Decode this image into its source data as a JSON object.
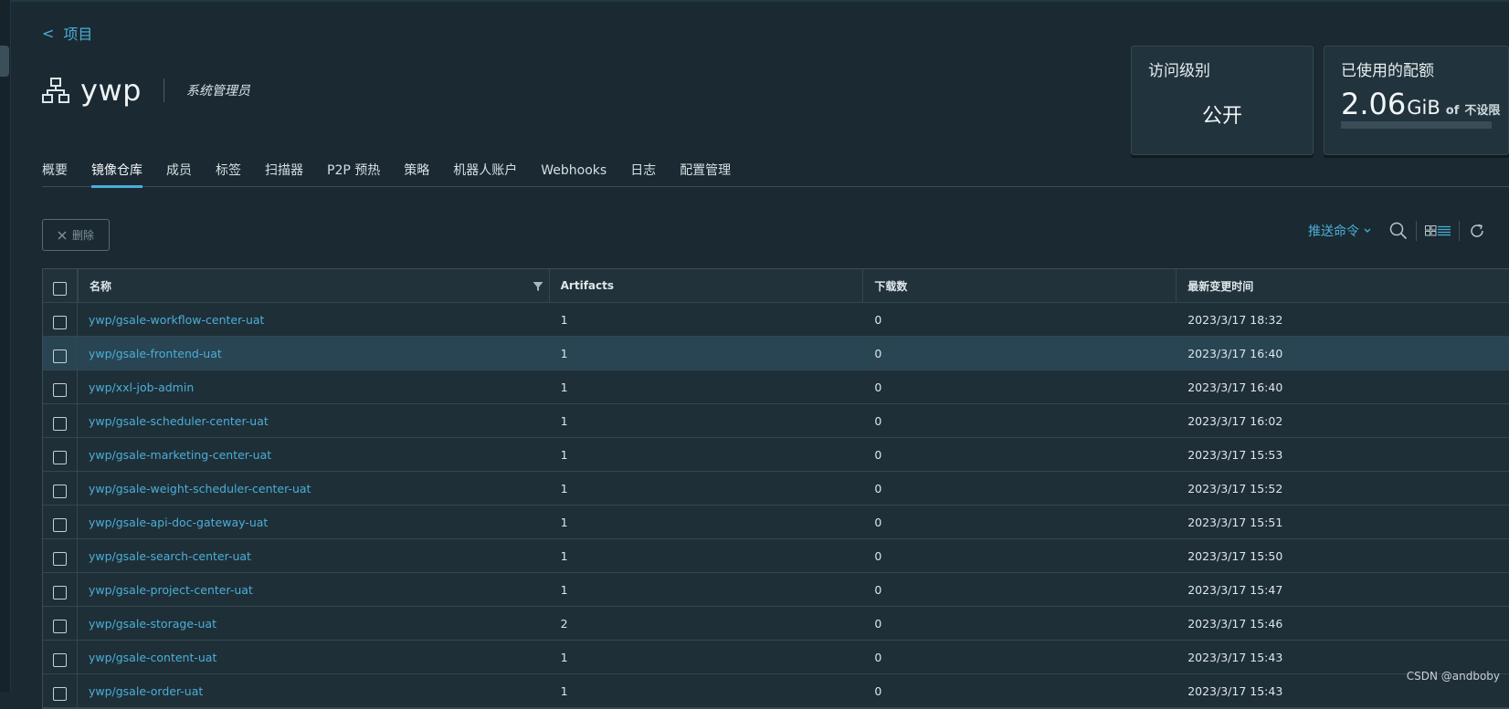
{
  "nav": {
    "back_label": "项目",
    "back_arrow": "<"
  },
  "project": {
    "name": "ywp",
    "role": "系统管理员",
    "icon": "project-tree-icon"
  },
  "cards": {
    "access": {
      "title": "访问级别",
      "value": "公开"
    },
    "quota": {
      "title": "已使用的配额",
      "used_value": "2.06",
      "used_unit": "GiB",
      "of_label": "of",
      "limit_label": "不设限"
    }
  },
  "tabs": [
    {
      "label": "概要",
      "active": false
    },
    {
      "label": "镜像仓库",
      "active": true
    },
    {
      "label": "成员",
      "active": false
    },
    {
      "label": "标签",
      "active": false
    },
    {
      "label": "扫描器",
      "active": false
    },
    {
      "label": "P2P 预热",
      "active": false
    },
    {
      "label": "策略",
      "active": false
    },
    {
      "label": "机器人账户",
      "active": false
    },
    {
      "label": "Webhooks",
      "active": false
    },
    {
      "label": "日志",
      "active": false
    },
    {
      "label": "配置管理",
      "active": false
    }
  ],
  "toolbar": {
    "delete_label": "删除",
    "push_command_label": "推送命令"
  },
  "table": {
    "columns": [
      "名称",
      "Artifacts",
      "下载数",
      "最新变更时间"
    ],
    "rows": [
      {
        "name": "ywp/gsale-workflow-center-uat",
        "artifacts": "1",
        "downloads": "0",
        "time": "2023/3/17 18:32"
      },
      {
        "name": "ywp/gsale-frontend-uat",
        "artifacts": "1",
        "downloads": "0",
        "time": "2023/3/17 16:40"
      },
      {
        "name": "ywp/xxl-job-admin",
        "artifacts": "1",
        "downloads": "0",
        "time": "2023/3/17 16:40"
      },
      {
        "name": "ywp/gsale-scheduler-center-uat",
        "artifacts": "1",
        "downloads": "0",
        "time": "2023/3/17 16:02"
      },
      {
        "name": "ywp/gsale-marketing-center-uat",
        "artifacts": "1",
        "downloads": "0",
        "time": "2023/3/17 15:53"
      },
      {
        "name": "ywp/gsale-weight-scheduler-center-uat",
        "artifacts": "1",
        "downloads": "0",
        "time": "2023/3/17 15:52"
      },
      {
        "name": "ywp/gsale-api-doc-gateway-uat",
        "artifacts": "1",
        "downloads": "0",
        "time": "2023/3/17 15:51"
      },
      {
        "name": "ywp/gsale-search-center-uat",
        "artifacts": "1",
        "downloads": "0",
        "time": "2023/3/17 15:50"
      },
      {
        "name": "ywp/gsale-project-center-uat",
        "artifacts": "1",
        "downloads": "0",
        "time": "2023/3/17 15:47"
      },
      {
        "name": "ywp/gsale-storage-uat",
        "artifacts": "2",
        "downloads": "0",
        "time": "2023/3/17 15:46"
      },
      {
        "name": "ywp/gsale-content-uat",
        "artifacts": "1",
        "downloads": "0",
        "time": "2023/3/17 15:43"
      },
      {
        "name": "ywp/gsale-order-uat",
        "artifacts": "1",
        "downloads": "0",
        "time": "2023/3/17 15:43"
      }
    ]
  },
  "watermark": "CSDN @andboby",
  "colors": {
    "accent": "#4aaed9",
    "background": "#1b2a32",
    "panel": "#21333c"
  }
}
